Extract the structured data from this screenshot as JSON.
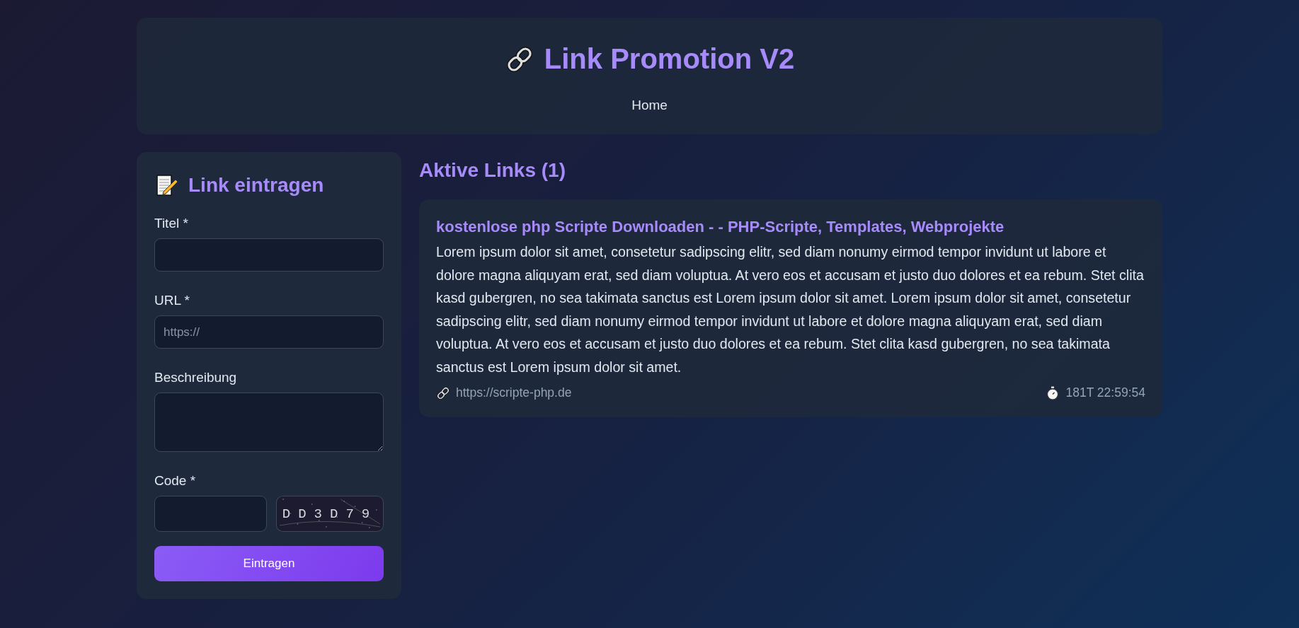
{
  "header": {
    "title": "Link Promotion V2",
    "nav": [
      {
        "label": "Home",
        "selected": false
      }
    ]
  },
  "form": {
    "title": "Link eintragen",
    "fields": [
      {
        "label": "Titel *",
        "kind": "input"
      },
      {
        "label": "URL *",
        "kind": "input",
        "placeholder": "https://"
      },
      {
        "label": "Beschreibung",
        "kind": "textarea"
      }
    ],
    "code": {
      "label": "Code *",
      "captcha": "DD3D79"
    },
    "submit": "Eintragen"
  },
  "links": {
    "heading": "Aktive Links (1)",
    "items": [
      {
        "title": "kostenlose php Scripte Downloaden - - PHP-Scripte, Templates, Webprojekte",
        "description": "Lorem ipsum dolor sit amet, consetetur sadipscing elitr, sed diam nonumy eirmod tempor invidunt ut labore et dolore magna aliquyam erat, sed diam voluptua. At vero eos et accusam et justo duo dolores et ea rebum. Stet clita kasd gubergren, no sea takimata sanctus est Lorem ipsum dolor sit amet. Lorem ipsum dolor sit amet, consetetur sadipscing elitr, sed diam nonumy eirmod tempor invidunt ut labore et dolore magna aliquyam erat, sed diam voluptua. At vero eos et accusam et justo duo dolores et ea rebum. Stet clita kasd gubergren, no sea takimata sanctus est Lorem ipsum dolor sit amet.",
        "url": "https://scripte-php.de",
        "time": "181T 22:59:54"
      }
    ]
  }
}
